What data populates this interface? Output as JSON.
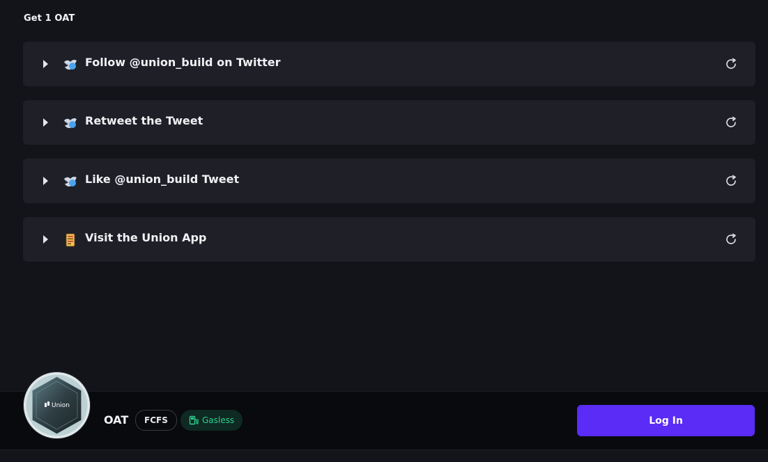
{
  "section": {
    "title": "Get 1 OAT"
  },
  "tasks": [
    {
      "label": "Follow @union_build on Twitter",
      "icon": "twitter-bird-icon"
    },
    {
      "label": "Retweet the Tweet",
      "icon": "twitter-bird-icon"
    },
    {
      "label": "Like @union_build Tweet",
      "icon": "twitter-bird-icon"
    },
    {
      "label": "Visit the Union App",
      "icon": "document-icon"
    }
  ],
  "footer": {
    "badge_text": "Union",
    "oat_name": "OAT",
    "tag_fcfs": "FCFS",
    "tag_gasless": "Gasless",
    "login_label": "Log In"
  },
  "colors": {
    "accent": "#5a2cf6",
    "gasless_green": "#2fcf8f",
    "card_bg": "#1e1f27",
    "page_bg": "#131419"
  }
}
